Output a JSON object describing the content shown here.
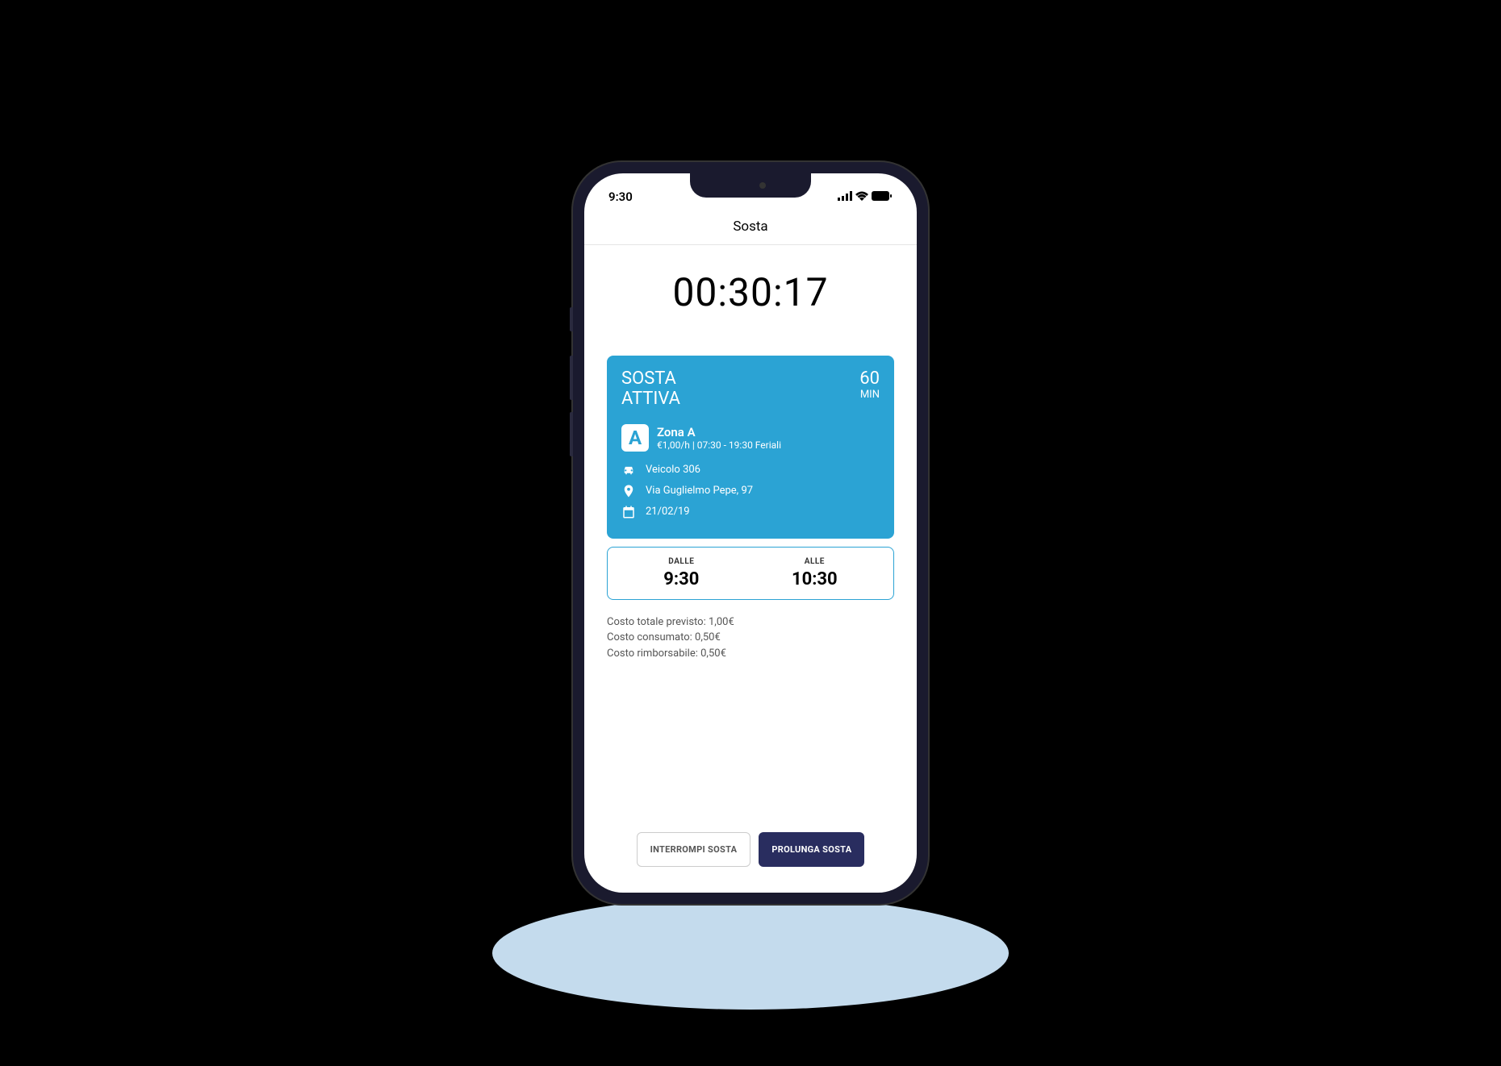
{
  "status_bar": {
    "time": "9:30"
  },
  "header": {
    "title": "Sosta"
  },
  "timer": "00:30:17",
  "card": {
    "status_line1": "SOSTA",
    "status_line2": "ATTIVA",
    "duration_value": "60",
    "duration_unit": "MIN",
    "zone_badge": "A",
    "zone_name": "Zona A",
    "zone_detail": "€1,00/h | 07:30 - 19:30 Feriali",
    "vehicle": "Veicolo 306",
    "location": "Via Guglielmo Pepe, 97",
    "date": "21/02/19"
  },
  "time_range": {
    "from_label": "DALLE",
    "from_value": "9:30",
    "to_label": "ALLE",
    "to_value": "10:30"
  },
  "costs": {
    "total": "Costo totale previsto: 1,00€",
    "consumed": "Costo consumato: 0,50€",
    "refundable": "Costo rimborsabile: 0,50€"
  },
  "buttons": {
    "stop": "INTERROMPI SOSTA",
    "extend": "PROLUNGA SOSTA"
  }
}
